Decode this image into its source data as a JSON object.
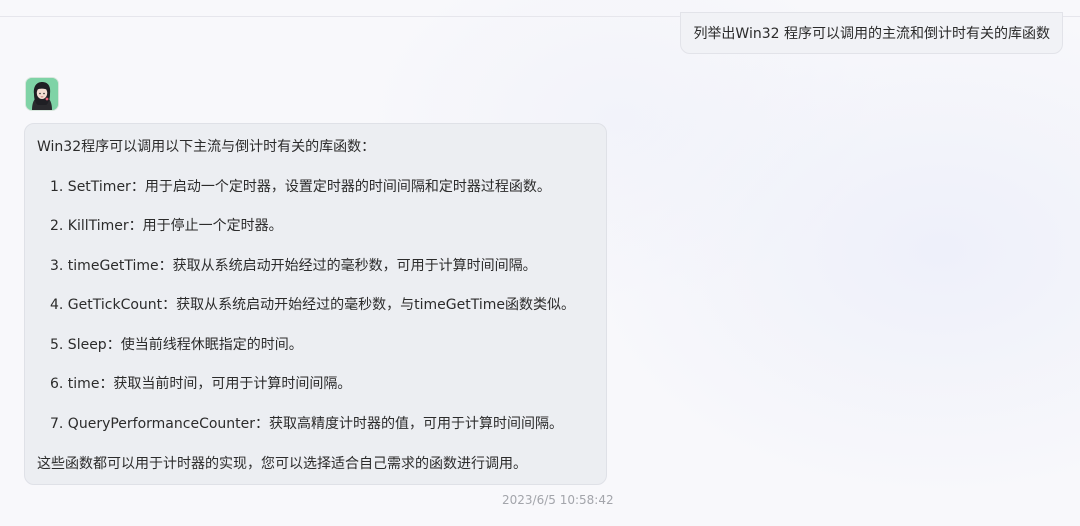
{
  "conversation": {
    "user_message": "列举出Win32 程序可以调用的主流和倒计时有关的库函数",
    "reply": {
      "intro": "Win32程序可以调用以下主流与倒计时有关的库函数：",
      "items": [
        "1. SetTimer：用于启动一个定时器，设置定时器的时间间隔和定时器过程函数。",
        "2. KillTimer：用于停止一个定时器。",
        "3. timeGetTime：获取从系统启动开始经过的毫秒数，可用于计算时间间隔。",
        "4. GetTickCount：获取从系统启动开始经过的毫秒数，与timeGetTime函数类似。",
        "5. Sleep：使当前线程休眠指定的时间。",
        "6. time：获取当前时间，可用于计算时间间隔。",
        "7. QueryPerformanceCounter：获取高精度计时器的值，可用于计算时间间隔。"
      ],
      "outro": "这些函数都可以用于计时器的实现，您可以选择适合自己需求的函数进行调用。"
    },
    "timestamp": "2023/6/5 10:58:42"
  },
  "colors": {
    "bubble_background": "#eceef2",
    "avatar_background": "#7fd3a6",
    "timestamp_text": "#a3a5ab"
  },
  "icons": {
    "assistant_avatar": "avatar-icon"
  }
}
